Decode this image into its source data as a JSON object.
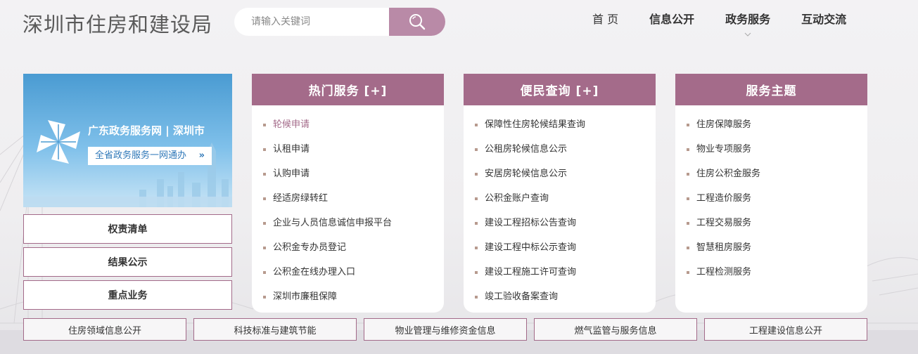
{
  "site": {
    "title": "深圳市住房和建设局"
  },
  "search": {
    "placeholder": "请输入关键词"
  },
  "nav": [
    {
      "label": "首 页"
    },
    {
      "label": "信息公开"
    },
    {
      "label": "政务服务"
    },
    {
      "label": "互动交流"
    }
  ],
  "banner": {
    "title": "广东政务服务网 | 深圳市",
    "subtitle": "全省政务服务一网通办",
    "arrow": "»"
  },
  "left_buttons": [
    {
      "label": "权责清单"
    },
    {
      "label": "结果公示"
    },
    {
      "label": "重点业务"
    }
  ],
  "panels": [
    {
      "title": "热门服务 [+]",
      "items": [
        "轮候申请",
        "认租申请",
        "认购申请",
        "经适房绿转红",
        "企业与人员信息诚信申报平台",
        "公积金专办员登记",
        "公积金在线办理入口",
        "深圳市廉租保障"
      ]
    },
    {
      "title": "便民查询 [+]",
      "items": [
        "保障性住房轮候结果查询",
        "公租房轮候信息公示",
        "安居房轮候信息公示",
        "公积金账户查询",
        "建设工程招标公告查询",
        "建设工程中标公示查询",
        "建设工程施工许可查询",
        "竣工验收备案查询"
      ]
    },
    {
      "title": "服务主题",
      "items": [
        "住房保障服务",
        "物业专项服务",
        "住房公积金服务",
        "工程造价服务",
        "工程交易服务",
        "智慧租房服务",
        "工程检测服务"
      ]
    }
  ],
  "bottom_buttons": [
    {
      "label": "住房领域信息公开"
    },
    {
      "label": "科技标准与建筑节能"
    },
    {
      "label": "物业管理与维修资金信息"
    },
    {
      "label": "燃气监管与服务信息"
    },
    {
      "label": "工程建设信息公开"
    }
  ],
  "colors": {
    "accent": "#a46b8a",
    "search_button": "#b98aa7",
    "banner_blue": "#4a9bd2"
  }
}
